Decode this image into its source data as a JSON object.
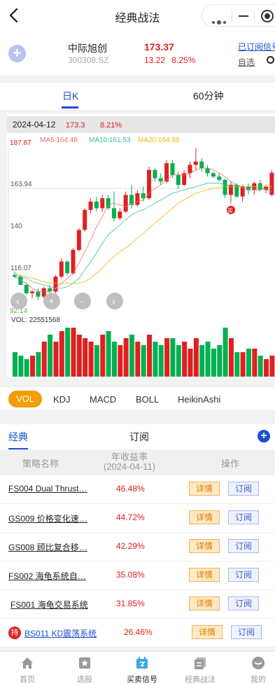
{
  "header": {
    "title": "经典战法",
    "back_icon": "chevron-left-icon",
    "more_icon": "more-dots-icon",
    "minimize_icon": "minimize-icon",
    "close_icon": "target-circle-icon"
  },
  "stock": {
    "name": "中际旭创",
    "code": "300308.SZ",
    "price": "173.37",
    "change": "13.22",
    "change_pct": "8.25%",
    "subscribed_label": "已订阅信号",
    "selfpick_label": "自选",
    "up_color": "#e02020",
    "down_color": "#00b050"
  },
  "period_tabs": [
    {
      "label": "日K",
      "active": true
    },
    {
      "label": "60分钟",
      "active": false
    }
  ],
  "chart_data": {
    "type": "candlestick",
    "info": {
      "date": "2024-04-12",
      "price": "173.3",
      "pct": "8.21%"
    },
    "max_label": "187.87",
    "min_label": "92.14",
    "ma": [
      {
        "name": "MA5",
        "value": "164.48",
        "color": "#ff6a6a"
      },
      {
        "name": "MA10",
        "value": "161.53",
        "color": "#33c3a6"
      },
      {
        "name": "MA20",
        "value": "164.98",
        "color": "#f5b800"
      }
    ],
    "y_ticks": [
      "163.94",
      "140",
      "116.07"
    ],
    "vol_label": "VOL: 22551568",
    "ylim": [
      92.14,
      187.87
    ],
    "buy_marker": "买",
    "candles": [
      [
        112,
        114,
        110,
        111
      ],
      [
        111,
        112,
        106,
        106
      ],
      [
        106,
        107,
        100,
        101
      ],
      [
        101,
        103,
        98,
        102
      ],
      [
        102,
        104,
        97,
        99
      ],
      [
        99,
        105,
        98,
        104
      ],
      [
        104,
        106,
        101,
        102
      ],
      [
        102,
        112,
        101,
        111
      ],
      [
        111,
        122,
        110,
        120
      ],
      [
        120,
        121,
        112,
        113
      ],
      [
        113,
        128,
        112,
        127
      ],
      [
        127,
        140,
        126,
        139
      ],
      [
        139,
        152,
        138,
        151
      ],
      [
        151,
        158,
        149,
        156
      ],
      [
        156,
        159,
        150,
        152
      ],
      [
        152,
        160,
        150,
        158
      ],
      [
        158,
        160,
        151,
        152
      ],
      [
        152,
        162,
        144,
        146
      ],
      [
        146,
        152,
        145,
        150
      ],
      [
        150,
        162,
        149,
        160
      ],
      [
        160,
        166,
        152,
        154
      ],
      [
        154,
        163,
        153,
        161
      ],
      [
        161,
        165,
        156,
        158
      ],
      [
        158,
        177,
        157,
        175
      ],
      [
        175,
        176,
        168,
        170
      ],
      [
        170,
        173,
        166,
        168
      ],
      [
        168,
        181,
        167,
        179
      ],
      [
        179,
        181,
        170,
        172
      ],
      [
        172,
        174,
        164,
        166
      ],
      [
        166,
        175,
        165,
        173
      ],
      [
        173,
        180,
        170,
        178
      ],
      [
        178,
        188,
        175,
        180
      ],
      [
        180,
        182,
        174,
        176
      ],
      [
        176,
        178,
        171,
        173
      ],
      [
        173,
        174,
        170,
        171
      ],
      [
        171,
        173,
        168,
        169
      ],
      [
        169,
        170,
        158,
        160
      ],
      [
        160,
        168,
        155,
        166
      ],
      [
        166,
        167,
        158,
        159
      ],
      [
        159,
        166,
        156,
        165
      ],
      [
        165,
        167,
        160,
        163
      ],
      [
        163,
        168,
        160,
        167
      ],
      [
        167,
        169,
        162,
        163
      ],
      [
        163,
        166,
        161,
        165
      ],
      [
        160,
        175,
        159,
        173.3
      ]
    ],
    "volumes": [
      7,
      6,
      5,
      6,
      7,
      10,
      12,
      10,
      13,
      14,
      14,
      12,
      11,
      10,
      9,
      12,
      13,
      10,
      9,
      11,
      12,
      10,
      9,
      12,
      10,
      9,
      11,
      11,
      9,
      10,
      8,
      11,
      9,
      10,
      8,
      9,
      14,
      11,
      7,
      7,
      8,
      8,
      6,
      5,
      6
    ],
    "ma5": [
      111,
      109,
      107,
      104,
      102,
      102,
      102,
      104,
      107,
      110,
      113,
      119,
      126,
      133,
      141,
      147,
      154,
      155,
      154,
      153,
      155,
      156,
      157,
      161,
      164,
      166,
      169,
      172,
      172,
      172,
      173,
      175,
      176,
      176,
      175,
      173,
      171,
      168,
      166,
      164,
      163,
      163,
      163,
      164,
      164
    ],
    "ma10": [
      112,
      111,
      110,
      108,
      107,
      106,
      105,
      104,
      104,
      105,
      107,
      110,
      115,
      120,
      125,
      131,
      136,
      139,
      142,
      145,
      148,
      150,
      151,
      153,
      155,
      157,
      159,
      161,
      162,
      163,
      164,
      165,
      166,
      167,
      167,
      167,
      166,
      166,
      166,
      165,
      165,
      164,
      164,
      163,
      162
    ],
    "ma20": [
      113,
      112,
      111,
      110,
      109,
      108,
      107,
      107,
      107,
      107,
      107,
      107,
      108,
      110,
      113,
      116,
      120,
      123,
      126,
      128,
      131,
      134,
      137,
      140,
      143,
      146,
      149,
      152,
      155,
      157,
      159,
      161,
      162,
      163,
      164,
      164,
      165,
      165,
      165,
      165,
      165,
      165,
      165,
      165,
      165
    ]
  },
  "indicator_tabs": [
    {
      "label": "VOL",
      "active": true
    },
    {
      "label": "KDJ"
    },
    {
      "label": "MACD"
    },
    {
      "label": "BOLL"
    },
    {
      "label": "HeikinAshi"
    }
  ],
  "strategy_tabs": [
    {
      "label": "经典",
      "active": true
    },
    {
      "label": "订阅"
    }
  ],
  "table": {
    "col_name": "策略名称",
    "col_return": "年收益率",
    "col_return_date": "(2024-04-11)",
    "col_action": "操作",
    "detail_label": "详情",
    "subscribe_label": "订阅",
    "hold_badge": "持",
    "rows": [
      {
        "name": "FS004 Dual Thrust…",
        "ret": "46.48%"
      },
      {
        "name": "GS009 价格变化速…",
        "ret": "44.72%"
      },
      {
        "name": "GS008 顾比复合移…",
        "ret": "42.29%"
      },
      {
        "name": "FS002 海龟系统自…",
        "ret": "35.08%"
      },
      {
        "name": "FS001 海龟交易系统",
        "ret": "31.85%"
      },
      {
        "name": "BS011 KD震荡系统",
        "ret": "26.46%"
      }
    ]
  },
  "tabbar": [
    {
      "label": "首页",
      "icon": "home-icon"
    },
    {
      "label": "选股",
      "icon": "star-box-icon"
    },
    {
      "label": "买卖信号",
      "icon": "signal-calendar-icon",
      "active": true
    },
    {
      "label": "经典战法",
      "icon": "documents-icon"
    },
    {
      "label": "我的",
      "icon": "profile-icon"
    }
  ]
}
